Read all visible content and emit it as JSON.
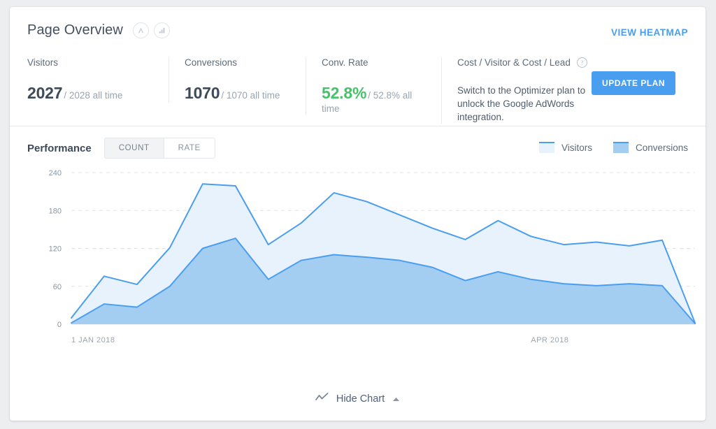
{
  "header": {
    "title": "Page Overview",
    "icons": [
      "peak-icon",
      "bar-chart-icon"
    ],
    "view_heatmap_label": "VIEW HEATMAP"
  },
  "stats": [
    {
      "label": "Visitors",
      "value": "2027",
      "sub": "/ 2028 all time",
      "accent": "#3d4a59"
    },
    {
      "label": "Conversions",
      "value": "1070",
      "sub": "/ 1070 all time",
      "accent": "#3d4a59"
    },
    {
      "label": "Conv. Rate",
      "value": "52.8%",
      "sub": "/ 52.8% all time",
      "accent": "#46c36a"
    }
  ],
  "cost_panel": {
    "label": "Cost / Visitor & Cost / Lead",
    "help_glyph": "?",
    "promo": "Switch to the Optimizer plan to unlock the Google AdWords integration.",
    "button_label": "UPDATE PLAN"
  },
  "performance": {
    "title": "Performance",
    "toggle": [
      {
        "label": "COUNT",
        "selected": true
      },
      {
        "label": "RATE",
        "selected": false
      }
    ],
    "legend": [
      {
        "label": "Visitors",
        "fill": "#e8f2fd",
        "stroke": "#4a9ef0"
      },
      {
        "label": "Conversions",
        "fill": "#a4cdf2",
        "stroke": "#4a9ef0"
      }
    ]
  },
  "footer": {
    "hide_chart_label": "Hide Chart",
    "chart_icon": "line-chart-icon",
    "caret": "caret-up-icon"
  },
  "chart_data": {
    "type": "area",
    "title": "Performance",
    "xlabel": "",
    "ylabel": "",
    "ylim": [
      0,
      240
    ],
    "yticks": [
      0,
      60,
      120,
      180,
      240
    ],
    "grid": true,
    "legend_position": "top-right",
    "x_tick_labels": [
      {
        "label": "1 JAN 2018",
        "index": 0
      },
      {
        "label": "APR 2018",
        "index": 14
      }
    ],
    "x": [
      0,
      1,
      2,
      3,
      4,
      5,
      6,
      7,
      8,
      9,
      10,
      11,
      12,
      13,
      14,
      15,
      16,
      17,
      18,
      19
    ],
    "series": [
      {
        "name": "Visitors",
        "fill": "#e8f2fd",
        "stroke": "#4a9ef0",
        "values": [
          10,
          76,
          63,
          121,
          222,
          219,
          126,
          160,
          208,
          194,
          173,
          152,
          134,
          164,
          139,
          126,
          130,
          124,
          133,
          2
        ]
      },
      {
        "name": "Conversions",
        "fill": "#a4cdf2",
        "stroke": "#4a9ef0",
        "values": [
          2,
          32,
          27,
          60,
          120,
          136,
          71,
          101,
          110,
          106,
          101,
          90,
          69,
          83,
          71,
          64,
          61,
          64,
          61,
          1
        ]
      }
    ]
  }
}
